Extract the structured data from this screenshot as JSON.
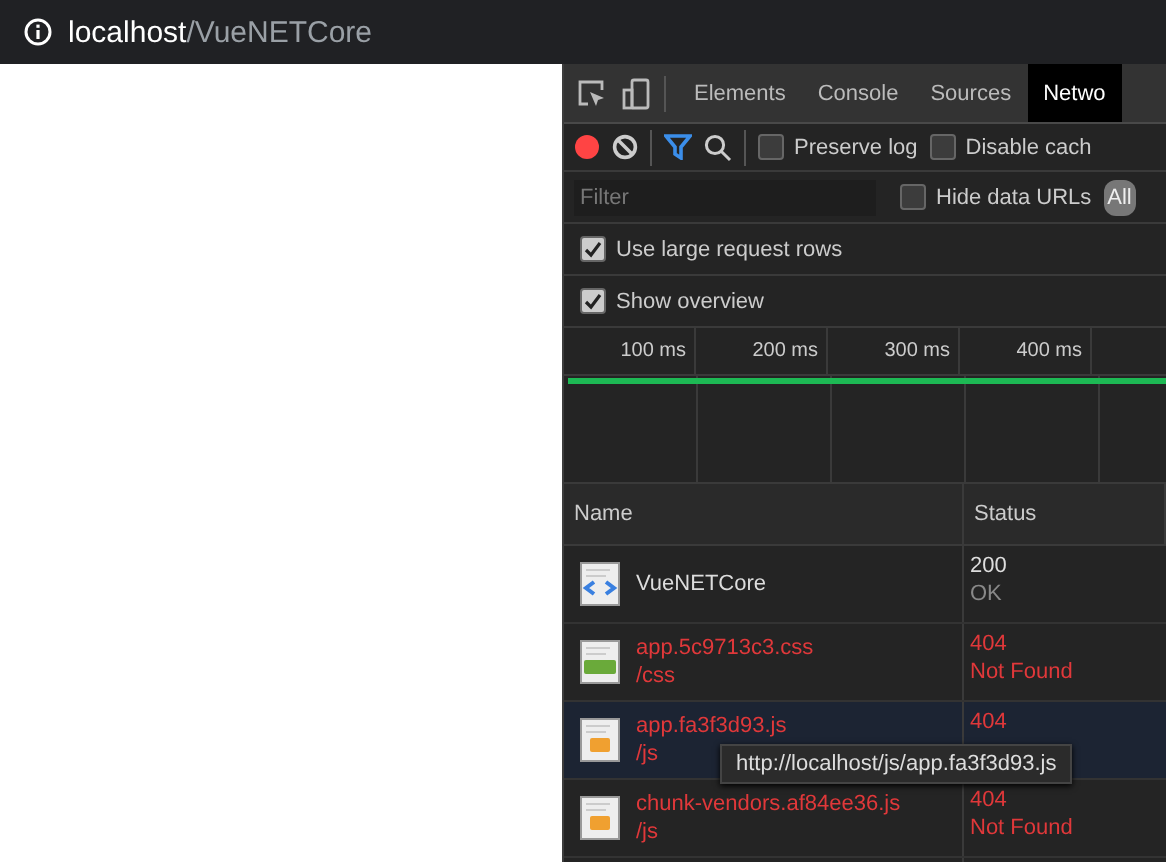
{
  "address_bar": {
    "host": "localhost",
    "path": "/VueNETCore"
  },
  "devtools": {
    "tabs": [
      {
        "label": "Elements",
        "selected": false
      },
      {
        "label": "Console",
        "selected": false
      },
      {
        "label": "Sources",
        "selected": false
      },
      {
        "label": "Netwo",
        "selected": true
      }
    ],
    "toolbar": {
      "recording": true,
      "filter_active": true,
      "checkboxes": [
        {
          "label": "Preserve log",
          "checked": false
        },
        {
          "label": "Disable cach",
          "checked": false
        }
      ]
    },
    "filter": {
      "placeholder": "Filter",
      "hide_data_urls": {
        "label": "Hide data URLs",
        "checked": false
      },
      "types": [
        {
          "label": "All",
          "selected": true
        }
      ]
    },
    "options": [
      {
        "label": "Use large request rows",
        "checked": true
      },
      {
        "label": "Show overview",
        "checked": true
      }
    ],
    "overview": {
      "ticks": [
        "100 ms",
        "200 ms",
        "300 ms",
        "400 ms"
      ]
    },
    "table": {
      "columns": [
        "Name",
        "Status"
      ],
      "rows": [
        {
          "kind": "doc",
          "name": "VueNETCore",
          "status": "200",
          "status_text": "OK",
          "error": false,
          "selected": false
        },
        {
          "kind": "css",
          "name": "app.5c9713c3.css",
          "path": "/css",
          "status": "404",
          "status_text": "Not Found",
          "error": true,
          "selected": false
        },
        {
          "kind": "js",
          "name": "app.fa3f3d93.js",
          "path": "/js",
          "status": "404",
          "error": true,
          "selected": true
        },
        {
          "kind": "js",
          "name": "chunk-vendors.af84ee36.js",
          "path": "/js",
          "status": "404",
          "status_text": "Not Found",
          "error": true,
          "selected": false
        }
      ]
    },
    "tooltip": "http://localhost/js/app.fa3f3d93.js"
  }
}
